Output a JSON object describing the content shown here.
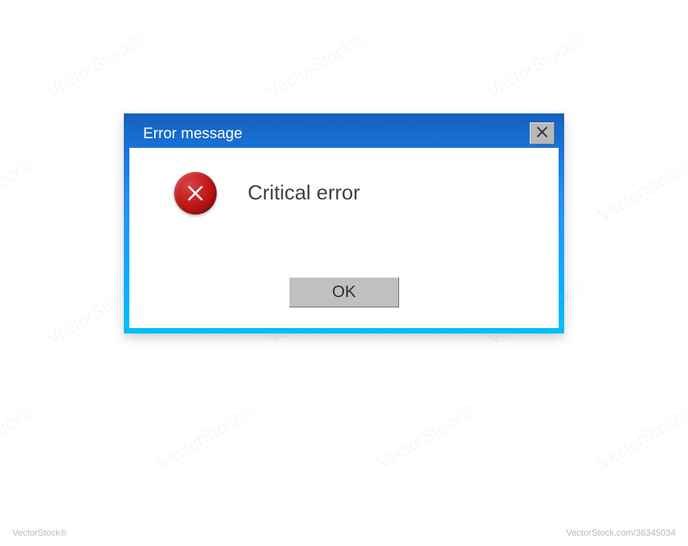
{
  "dialog": {
    "title": "Error message",
    "message": "Critical error",
    "ok_label": "OK"
  },
  "watermark": {
    "brand": "VectorStock®",
    "id": "VectorStock.com/36345034",
    "diag": "VectorStock®"
  }
}
